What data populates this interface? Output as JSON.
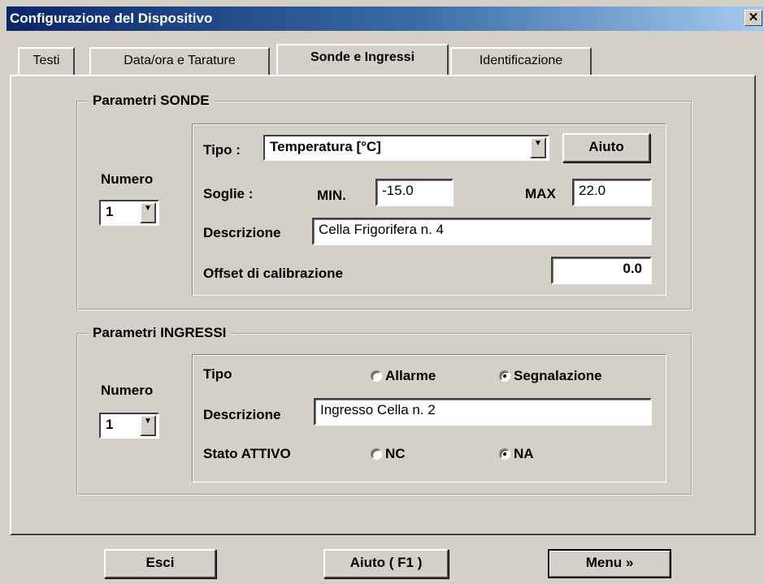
{
  "window": {
    "title": "Configurazione del Dispositivo",
    "close_glyph": "✕"
  },
  "tabs": [
    {
      "label": "Testi"
    },
    {
      "label": "Data/ora e Tarature"
    },
    {
      "label": "Sonde e Ingressi"
    },
    {
      "label": "Identificazione"
    }
  ],
  "sonde": {
    "group_label": "Parametri SONDE",
    "numero_label": "Numero",
    "numero_value": "1",
    "tipo_label": "Tipo :",
    "tipo_value": "Temperatura [°C]",
    "aiuto_label": "Aiuto",
    "soglie_label": "Soglie :",
    "min_label": "MIN.",
    "min_value": "-15.0",
    "max_label": "MAX",
    "max_value": "22.0",
    "descrizione_label": "Descrizione",
    "descrizione_value": "Cella  Frigorifera  n.  4",
    "offset_label": "Offset di calibrazione",
    "offset_value": "0.0"
  },
  "ingressi": {
    "group_label": "Parametri INGRESSI",
    "numero_label": "Numero",
    "numero_value": "1",
    "tipo_label": "Tipo",
    "allarme_label": "Allarme",
    "segnalazione_label": "Segnalazione",
    "tipo_selected": "Segnalazione",
    "descrizione_label": "Descrizione",
    "descrizione_value": "Ingresso  Cella n. 2",
    "stato_label": "Stato ATTIVO",
    "nc_label": "NC",
    "na_label": "NA",
    "stato_selected": "NA"
  },
  "footer": {
    "esci_label": "Esci",
    "aiuto_f1_label": "Aiuto ( F1 )",
    "menu_label": "Menu »"
  }
}
